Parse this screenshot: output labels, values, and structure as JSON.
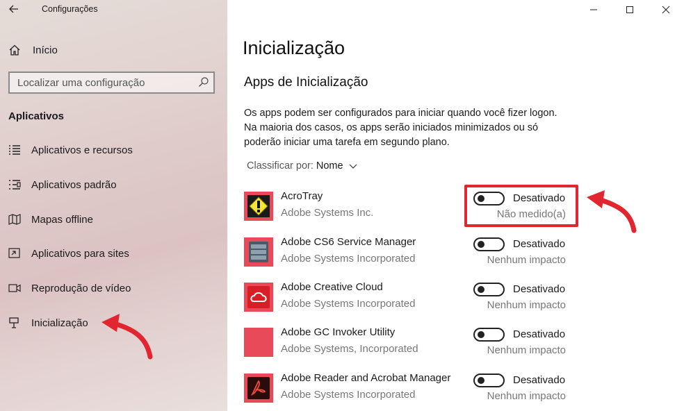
{
  "window": {
    "title": "Configurações",
    "back_icon": "back-arrow-icon",
    "controls": [
      "minimize-icon",
      "maximize-icon",
      "close-icon"
    ]
  },
  "sidebar": {
    "home_label": "Início",
    "search_placeholder": "Localizar uma configuração",
    "section_title": "Aplicativos",
    "items": [
      {
        "label": "Aplicativos e recursos",
        "icon": "list-icon"
      },
      {
        "label": "Aplicativos padrão",
        "icon": "default-apps-icon"
      },
      {
        "label": "Mapas offline",
        "icon": "map-icon"
      },
      {
        "label": "Aplicativos para sites",
        "icon": "link-window-icon"
      },
      {
        "label": "Reprodução de vídeo",
        "icon": "video-icon"
      },
      {
        "label": "Inicialização",
        "icon": "startup-icon"
      }
    ]
  },
  "main": {
    "title": "Inicialização",
    "subtitle": "Apps de Inicialização",
    "description": "Os apps podem ser configurados para iniciar quando você fizer logon. Na maioria dos casos, os apps serão iniciados minimizados ou só poderão iniciar uma tarefa em segundo plano.",
    "sort_label": "Classificar por:",
    "sort_value": "Nome",
    "apps": [
      {
        "name": "AcroTray",
        "publisher": "Adobe Systems Inc.",
        "state": "Desativado",
        "impact": "Não medido(a)",
        "enabled": false,
        "icon_color": "#e84a5a"
      },
      {
        "name": "Adobe CS6 Service Manager",
        "publisher": "Adobe Systems Incorporated",
        "state": "Desativado",
        "impact": "Nenhum impacto",
        "enabled": false,
        "icon_color": "#e84a5a"
      },
      {
        "name": "Adobe Creative Cloud",
        "publisher": "Adobe Systems Incorporated",
        "state": "Desativado",
        "impact": "Nenhum impacto",
        "enabled": false,
        "icon_color": "#e84a5a"
      },
      {
        "name": "Adobe GC Invoker Utility",
        "publisher": "Adobe Systems, Incorporated",
        "state": "Desativado",
        "impact": "Nenhum impacto",
        "enabled": false,
        "icon_color": "#e84a5a"
      },
      {
        "name": "Adobe Reader and Acrobat Manager",
        "publisher": "Adobe Systems Incorporated",
        "state": "Desativado",
        "impact": "Nenhum impacto",
        "enabled": false,
        "icon_color": "#e84a5a"
      }
    ]
  },
  "colors": {
    "annotation_red": "#e2262f",
    "tile_red": "#e84a5a"
  }
}
